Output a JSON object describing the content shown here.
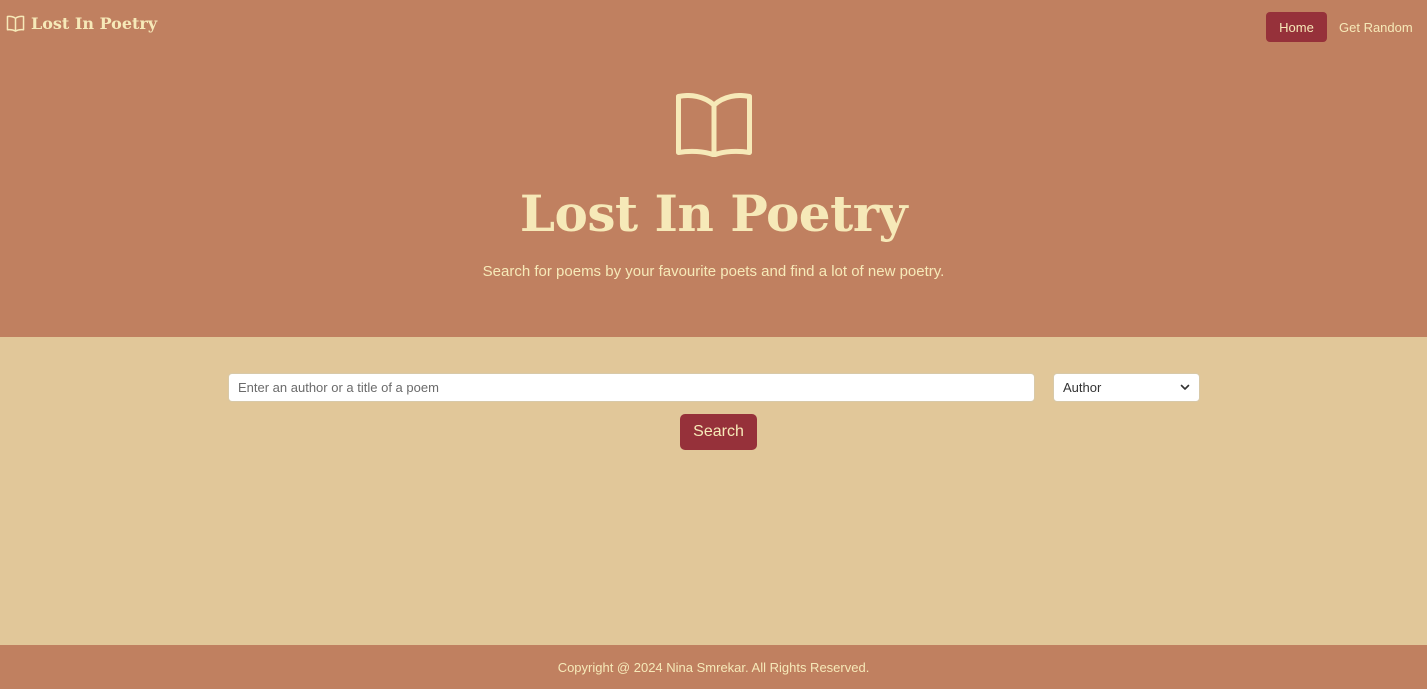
{
  "colors": {
    "hero_bg": "#c08060",
    "content_bg": "#e1c799",
    "accent": "#96313a",
    "text_light": "#f6e9b8"
  },
  "navbar": {
    "brand": {
      "icon": "book-icon",
      "label": "Lost In Poetry"
    },
    "links": [
      {
        "label": "Home",
        "active": true
      },
      {
        "label": "Get Random",
        "active": false
      }
    ]
  },
  "hero": {
    "icon": "book-icon",
    "title": "Lost In Poetry",
    "subtitle": "Search for poems by your favourite poets and find a lot of new poetry."
  },
  "search": {
    "value": "",
    "placeholder": "Enter an author or a title of a poem",
    "filter": {
      "selected": "Author",
      "icon": "chevron-down-icon"
    },
    "button_label": "Search"
  },
  "footer": {
    "copyright": "Copyright @ 2024 Nina Smrekar. All Rights Reserved."
  }
}
